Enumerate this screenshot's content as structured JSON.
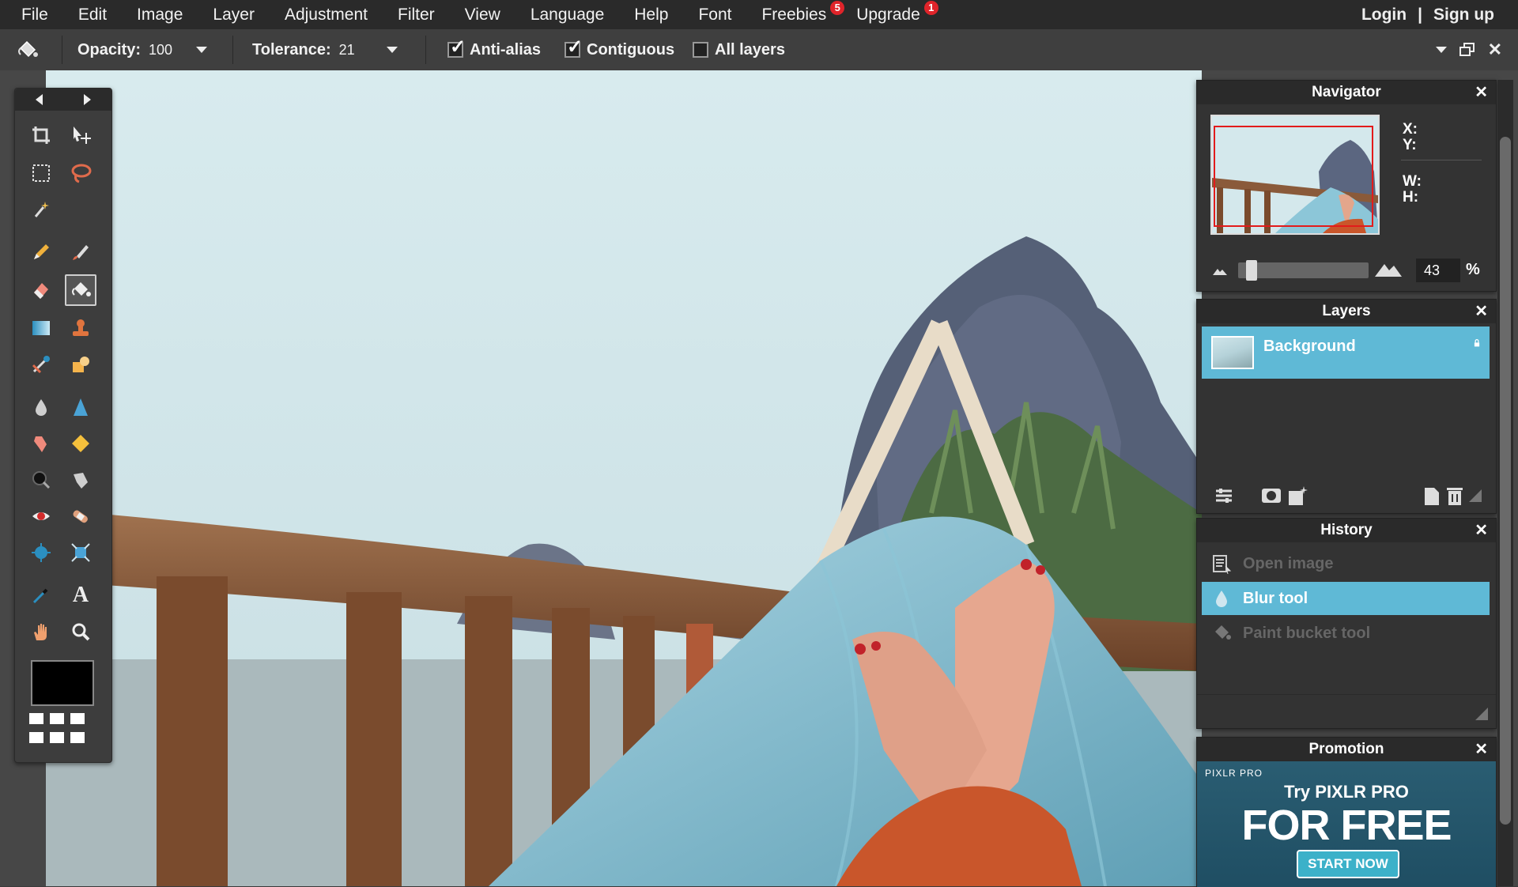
{
  "menu": {
    "items": [
      {
        "label": "File"
      },
      {
        "label": "Edit"
      },
      {
        "label": "Image"
      },
      {
        "label": "Layer"
      },
      {
        "label": "Adjustment"
      },
      {
        "label": "Filter"
      },
      {
        "label": "View"
      },
      {
        "label": "Language"
      },
      {
        "label": "Help"
      },
      {
        "label": "Font"
      },
      {
        "label": "Freebies",
        "badge": "5"
      },
      {
        "label": "Upgrade",
        "badge": "1"
      }
    ],
    "login": "Login",
    "separator": "|",
    "signup": "Sign up"
  },
  "options": {
    "active_tool_icon": "paint-bucket-icon",
    "opacity_label": "Opacity:",
    "opacity_value": "100",
    "tolerance_label": "Tolerance:",
    "tolerance_value": "21",
    "antialias_label": "Anti-alias",
    "antialias_checked": true,
    "contiguous_label": "Contiguous",
    "contiguous_checked": true,
    "all_layers_label": "All layers",
    "all_layers_checked": false
  },
  "toolbox": {
    "foreground_color": "#000000",
    "tools": [
      "crop-icon",
      "move-icon",
      "marquee-icon",
      "lasso-icon",
      "magic-wand-icon",
      "pencil-icon",
      "brush-icon",
      "eraser-icon",
      "paint-bucket-icon",
      "gradient-icon",
      "clone-stamp-icon",
      "color-replace-icon",
      "drawing-icon",
      "blur-icon",
      "sharpen-icon",
      "smudge-icon",
      "sponge-icon",
      "dodge-icon",
      "burn-icon",
      "red-eye-icon",
      "spot-heal-icon",
      "bloat-icon",
      "pinch-icon",
      "color-picker-icon",
      "type-icon",
      "hand-icon",
      "zoom-icon"
    ],
    "active_tool": "paint-bucket-icon"
  },
  "navigator": {
    "title": "Navigator",
    "x_label": "X:",
    "y_label": "Y:",
    "w_label": "W:",
    "h_label": "H:",
    "zoom_value": "43",
    "zoom_unit": "%"
  },
  "layers": {
    "title": "Layers",
    "items": [
      {
        "name": "Background",
        "locked": true
      }
    ]
  },
  "history": {
    "title": "History",
    "items": [
      {
        "label": "Open image",
        "state": "dim",
        "icon": "document-icon"
      },
      {
        "label": "Blur tool",
        "state": "selected",
        "icon": "blur-icon"
      },
      {
        "label": "Paint bucket tool",
        "state": "dim",
        "icon": "paint-bucket-icon"
      }
    ]
  },
  "promotion": {
    "title": "Promotion",
    "brand": "PIXLR PRO",
    "line1": "Try PIXLR PRO",
    "line2": "FOR FREE",
    "button": "START NOW"
  },
  "colors": {
    "accent": "#5fb9d6",
    "badge": "#e0242a",
    "selection_box": "#e31b1b"
  }
}
